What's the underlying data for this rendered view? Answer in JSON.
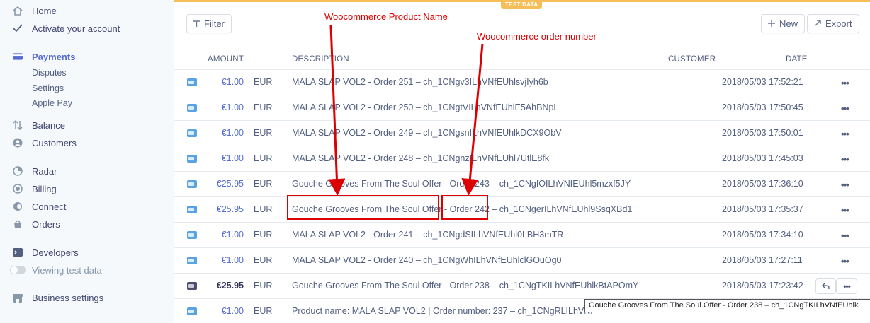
{
  "sidebar": {
    "home": "Home",
    "activate": "Activate your account",
    "payments": "Payments",
    "payments_sub": [
      "Disputes",
      "Settings",
      "Apple Pay"
    ],
    "balance": "Balance",
    "customers": "Customers",
    "radar": "Radar",
    "billing": "Billing",
    "connect": "Connect",
    "orders": "Orders",
    "developers": "Developers",
    "viewing_test": "Viewing test data",
    "business_settings": "Business settings"
  },
  "header": {
    "test_badge": "TEST DATA",
    "filter_label": "Filter",
    "new_label": "New",
    "export_label": "Export"
  },
  "table": {
    "columns": {
      "amount": "AMOUNT",
      "description": "DESCRIPTION",
      "customer": "CUSTOMER",
      "date": "DATE"
    },
    "rows": [
      {
        "amount": "€1.00",
        "currency": "EUR",
        "description": "MALA SLAP VOL2 - Order 251 – ch_1CNgv3ILhVNfEUhlsvjIyh6b",
        "date": "2018/05/03 17:52:21"
      },
      {
        "amount": "€1.00",
        "currency": "EUR",
        "description": "MALA SLAP VOL2 - Order 250 – ch_1CNgtVILhVNfEUhlE5AhBNpL",
        "date": "2018/05/03 17:50:45"
      },
      {
        "amount": "€1.00",
        "currency": "EUR",
        "description": "MALA SLAP VOL2 - Order 249 – ch_1CNgsnILhVNfEUhlkDCX9ObV",
        "date": "2018/05/03 17:50:01"
      },
      {
        "amount": "€1.00",
        "currency": "EUR",
        "description": "MALA SLAP VOL2 - Order 248 – ch_1CNgnzILhVNfEUhl7UtlE8fk",
        "date": "2018/05/03 17:45:03"
      },
      {
        "amount": "€25.95",
        "currency": "EUR",
        "description": "Gouche Grooves From The Soul Offer - Order 243 – ch_1CNgfOILhVNfEUhl5mzxf5JY",
        "date": "2018/05/03 17:36:10"
      },
      {
        "amount": "€25.95",
        "currency": "EUR",
        "desc_part1": "Gouche Grooves From The Soul Offer",
        "desc_sep": " - ",
        "desc_part2": "Order 242",
        "desc_part3": " – ch_1CNgerILhVNfEUhl9SsqXBd1",
        "date": "2018/05/03 17:35:37"
      },
      {
        "amount": "€1.00",
        "currency": "EUR",
        "description": "MALA SLAP VOL2 - Order 241 – ch_1CNgdSILhVNfEUhl0LBH3mTR",
        "date": "2018/05/03 17:34:10"
      },
      {
        "amount": "€1.00",
        "currency": "EUR",
        "description": "MALA SLAP VOL2 - Order 240 – ch_1CNgWhILhVNfEUhlclGOuOg0",
        "date": "2018/05/03 17:27:11"
      },
      {
        "amount": "€25.95",
        "currency": "EUR",
        "description": "Gouche Grooves From The Soul Offer - Order 238 – ch_1CNgTKILhVNfEUhlkBtAPOmY",
        "date": "2018/05/03 17:23:42"
      },
      {
        "amount": "€1.00",
        "currency": "EUR",
        "description": "Product name: MALA SLAP VOL2 | Order number: 237 – ch_1CNgRLILhVNf"
      }
    ]
  },
  "annotations": {
    "product_name": "Woocommerce Product Name",
    "order_number": "Woocommerce order number"
  },
  "tooltip": "Gouche Grooves From The Soul Offer - Order 238 – ch_1CNgTKILhVNfEUhlk",
  "colors": {
    "accent": "#556cd6",
    "test_data": "#f5be58",
    "annotation": "#dd0000"
  }
}
